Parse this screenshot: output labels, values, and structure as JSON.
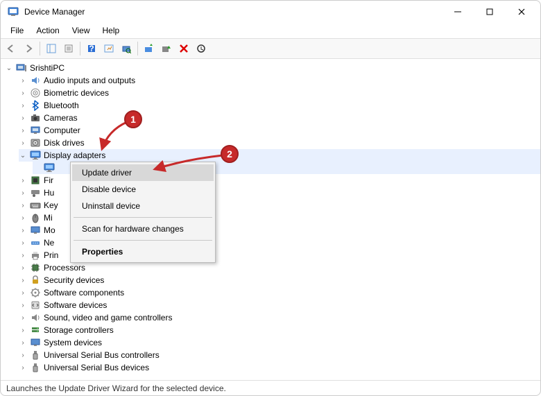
{
  "window": {
    "title": "Device Manager"
  },
  "menu": [
    "File",
    "Action",
    "View",
    "Help"
  ],
  "root": "SrishtiPC",
  "categories": [
    {
      "label": "Audio inputs and outputs",
      "icon": "audio"
    },
    {
      "label": "Biometric devices",
      "icon": "biometric"
    },
    {
      "label": "Bluetooth",
      "icon": "bluetooth"
    },
    {
      "label": "Cameras",
      "icon": "camera"
    },
    {
      "label": "Computer",
      "icon": "computer"
    },
    {
      "label": "Disk drives",
      "icon": "disk"
    },
    {
      "label": "Display adapters",
      "icon": "display",
      "expanded": true
    },
    {
      "label": "Fir",
      "icon": "firmware"
    },
    {
      "label": "Hu",
      "icon": "hid"
    },
    {
      "label": "Key",
      "icon": "keyboard"
    },
    {
      "label": "Mi",
      "icon": "mouse"
    },
    {
      "label": "Mo",
      "icon": "monitor"
    },
    {
      "label": "Ne",
      "icon": "network"
    },
    {
      "label": "Prin",
      "icon": "printqueue"
    },
    {
      "label": "Processors",
      "icon": "cpu"
    },
    {
      "label": "Security devices",
      "icon": "security"
    },
    {
      "label": "Software components",
      "icon": "swcomp"
    },
    {
      "label": "Software devices",
      "icon": "swdev"
    },
    {
      "label": "Sound, video and game controllers",
      "icon": "sound"
    },
    {
      "label": "Storage controllers",
      "icon": "storage"
    },
    {
      "label": "System devices",
      "icon": "system"
    },
    {
      "label": "Universal Serial Bus controllers",
      "icon": "usb"
    },
    {
      "label": "Universal Serial Bus devices",
      "icon": "usb"
    }
  ],
  "context_menu": {
    "items": [
      {
        "label": "Update driver",
        "hover": true
      },
      {
        "label": "Disable device"
      },
      {
        "label": "Uninstall device"
      },
      {
        "sep": true
      },
      {
        "label": "Scan for hardware changes"
      },
      {
        "sep": true
      },
      {
        "label": "Properties",
        "bold": true
      }
    ]
  },
  "status": "Launches the Update Driver Wizard for the selected device.",
  "annotations": {
    "badge1": "1",
    "badge2": "2"
  }
}
